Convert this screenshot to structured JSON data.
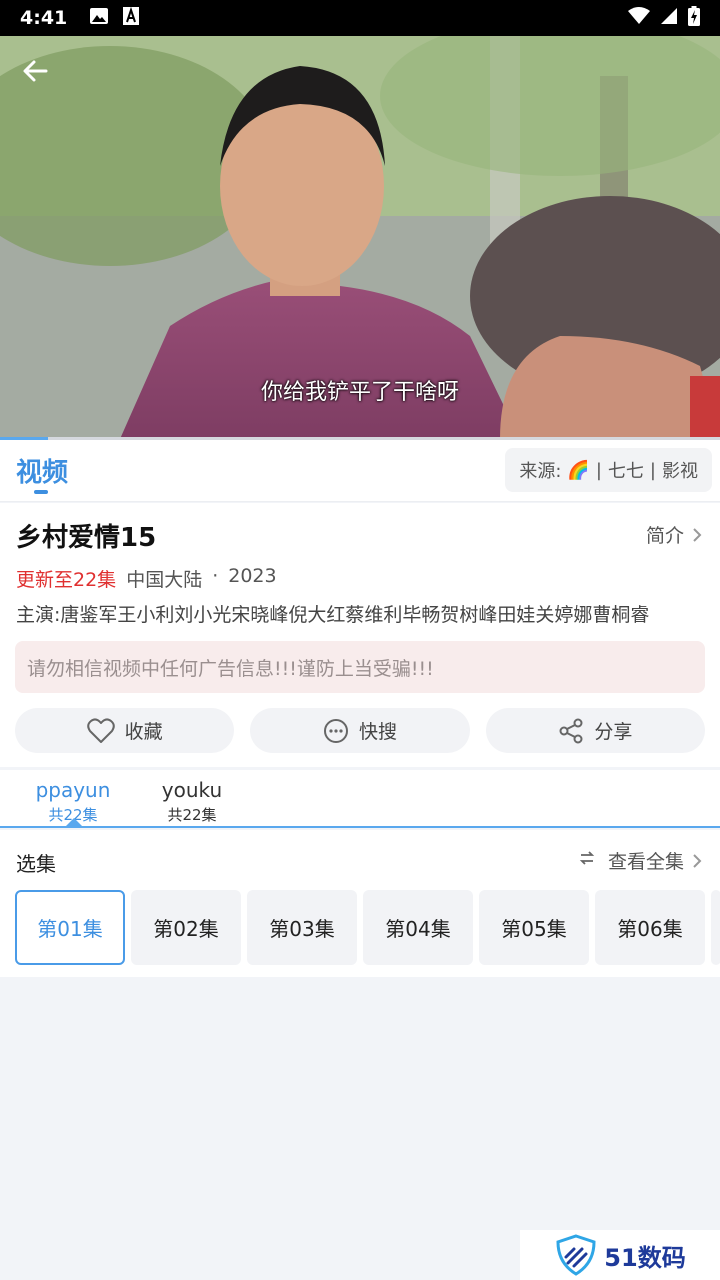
{
  "status_bar": {
    "time": "4:41"
  },
  "player": {
    "subtitle": "你给我铲平了干啥呀",
    "progress_fraction": 0.067
  },
  "tabs": {
    "video_label": "视频"
  },
  "source": {
    "label": "来源:",
    "emoji": "🌈",
    "sep1": "|",
    "name": "七七",
    "sep2": "|",
    "suffix": "影视"
  },
  "show": {
    "title": "乡村爱情15",
    "intro_label": "简介",
    "update": "更新至22集",
    "region": "中国大陆",
    "dot": "·",
    "year": "2023",
    "cast": "主演:唐鉴军王小利刘小光宋晓峰倪大红蔡维利毕畅贺树峰田娃关婷娜曹桐睿"
  },
  "warning": "请勿相信视频中任何广告信息!!!谨防上当受骗!!!",
  "actions": [
    {
      "label": "收藏",
      "icon": "heart-icon"
    },
    {
      "label": "快搜",
      "icon": "dots-circle-icon"
    },
    {
      "label": "分享",
      "icon": "share-icon"
    }
  ],
  "play_sources": [
    {
      "name": "ppayun",
      "count": "共22集",
      "active": true
    },
    {
      "name": "youku",
      "count": "共22集",
      "active": false
    }
  ],
  "episodes": {
    "header": "选集",
    "view_all": "查看全集",
    "items": [
      "第01集",
      "第02集",
      "第03集",
      "第04集",
      "第05集",
      "第06集"
    ]
  },
  "watermark": {
    "text": "51数码"
  },
  "colors": {
    "accent": "#3d8fe0",
    "update_red": "#e03030",
    "warning_bg": "#f8ecec"
  }
}
